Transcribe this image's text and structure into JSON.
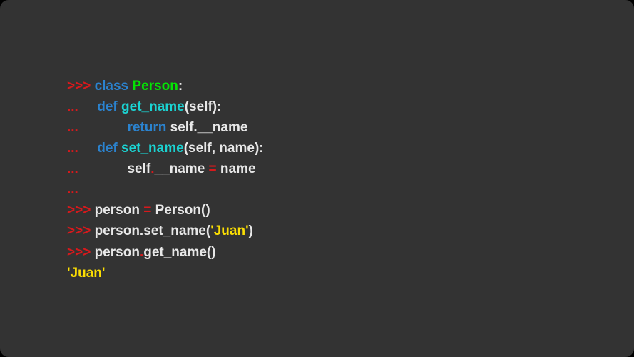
{
  "lines": [
    [
      {
        "t": ">>> ",
        "c": "c-red"
      },
      {
        "t": "class ",
        "c": "c-blue"
      },
      {
        "t": "Person",
        "c": "c-green"
      },
      {
        "t": ":",
        "c": "c-white"
      }
    ],
    [
      {
        "t": "...     ",
        "c": "c-red"
      },
      {
        "t": "def ",
        "c": "c-blue"
      },
      {
        "t": "get_name",
        "c": "c-cyan"
      },
      {
        "t": "(self):",
        "c": "c-white"
      }
    ],
    [
      {
        "t": "...             ",
        "c": "c-red"
      },
      {
        "t": "return ",
        "c": "c-blue"
      },
      {
        "t": "self.__name",
        "c": "c-white"
      }
    ],
    [
      {
        "t": "...     ",
        "c": "c-red"
      },
      {
        "t": "def ",
        "c": "c-blue"
      },
      {
        "t": "set_name",
        "c": "c-cyan"
      },
      {
        "t": "(self, name):",
        "c": "c-white"
      }
    ],
    [
      {
        "t": "...             ",
        "c": "c-red"
      },
      {
        "t": "self",
        "c": "c-white"
      },
      {
        "t": ".",
        "c": "c-red"
      },
      {
        "t": "__name ",
        "c": "c-white"
      },
      {
        "t": "= ",
        "c": "c-red"
      },
      {
        "t": "name",
        "c": "c-white"
      }
    ],
    [
      {
        "t": "...",
        "c": "c-red"
      }
    ],
    [
      {
        "t": ">>> ",
        "c": "c-red"
      },
      {
        "t": "person ",
        "c": "c-white"
      },
      {
        "t": "= ",
        "c": "c-red"
      },
      {
        "t": "Person()",
        "c": "c-white"
      }
    ],
    [
      {
        "t": ">>> ",
        "c": "c-red"
      },
      {
        "t": "person.set_name(",
        "c": "c-white"
      },
      {
        "t": "'Juan'",
        "c": "c-yellow"
      },
      {
        "t": ")",
        "c": "c-white"
      }
    ],
    [
      {
        "t": ">>> ",
        "c": "c-red"
      },
      {
        "t": "person",
        "c": "c-white"
      },
      {
        "t": ".",
        "c": "c-red"
      },
      {
        "t": "get_name()",
        "c": "c-white"
      }
    ],
    [
      {
        "t": "'Juan'",
        "c": "c-yellow"
      }
    ]
  ]
}
